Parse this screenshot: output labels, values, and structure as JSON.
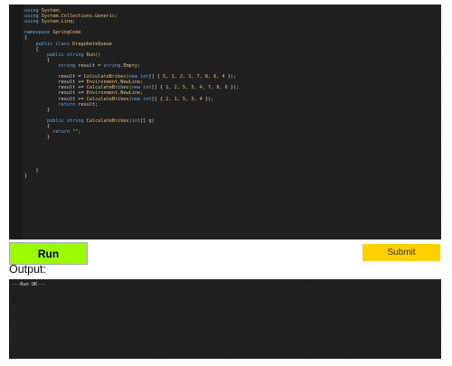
{
  "editor": {
    "lines": [
      [
        {
          "t": "using",
          "c": "kw"
        },
        {
          "t": " System;",
          "c": "type"
        }
      ],
      [
        {
          "t": "using",
          "c": "kw"
        },
        {
          "t": " System.Collections.Generic;",
          "c": "type"
        }
      ],
      [
        {
          "t": "using",
          "c": "kw"
        },
        {
          "t": " System.Linq;",
          "c": "type"
        }
      ],
      [
        {
          "t": "",
          "c": "plain"
        }
      ],
      [
        {
          "t": "namespace",
          "c": "kw"
        },
        {
          "t": " SpringCode",
          "c": "type"
        }
      ],
      [
        {
          "t": "{",
          "c": "plain"
        }
      ],
      [
        {
          "t": "    public class",
          "c": "kw"
        },
        {
          "t": " DragobeteQueue",
          "c": "type"
        }
      ],
      [
        {
          "t": "    {",
          "c": "plain"
        }
      ],
      [
        {
          "t": "        public string",
          "c": "kw"
        },
        {
          "t": " Run()",
          "c": "type"
        }
      ],
      [
        {
          "t": "        {",
          "c": "plain"
        }
      ],
      [
        {
          "t": "            string",
          "c": "kw"
        },
        {
          "t": " result = ",
          "c": "plain"
        },
        {
          "t": "string",
          "c": "kw"
        },
        {
          "t": ".Empty;",
          "c": "type"
        }
      ],
      [
        {
          "t": "",
          "c": "plain"
        }
      ],
      [
        {
          "t": "            result = ",
          "c": "plain"
        },
        {
          "t": "CalculateBribes(",
          "c": "type"
        },
        {
          "t": "new int",
          "c": "kw"
        },
        {
          "t": "[] { ",
          "c": "plain"
        },
        {
          "t": "5, 1, 2, 3, 7, 8, 6, 4",
          "c": "num"
        },
        {
          "t": " });",
          "c": "plain"
        }
      ],
      [
        {
          "t": "            result += ",
          "c": "plain"
        },
        {
          "t": "Environment.NewLine;",
          "c": "type"
        }
      ],
      [
        {
          "t": "            result += ",
          "c": "plain"
        },
        {
          "t": "CalculateBribes(",
          "c": "type"
        },
        {
          "t": "new int",
          "c": "kw"
        },
        {
          "t": "[] { ",
          "c": "plain"
        },
        {
          "t": "1, 2, 5, 3, 4, 7, 8, 6",
          "c": "num"
        },
        {
          "t": " });",
          "c": "plain"
        }
      ],
      [
        {
          "t": "            result += ",
          "c": "plain"
        },
        {
          "t": "Environment.NewLine;",
          "c": "type"
        }
      ],
      [
        {
          "t": "            result += ",
          "c": "plain"
        },
        {
          "t": "CalculateBribes(",
          "c": "type"
        },
        {
          "t": "new int",
          "c": "kw"
        },
        {
          "t": "[] { ",
          "c": "plain"
        },
        {
          "t": "2, 1, 5, 3, 4",
          "c": "num"
        },
        {
          "t": " });",
          "c": "plain"
        }
      ],
      [
        {
          "t": "            return",
          "c": "kw"
        },
        {
          "t": " result;",
          "c": "plain"
        }
      ],
      [
        {
          "t": "        }",
          "c": "plain"
        }
      ],
      [
        {
          "t": "",
          "c": "plain"
        }
      ],
      [
        {
          "t": "        public string",
          "c": "kw"
        },
        {
          "t": " CalculateBribes(",
          "c": "type"
        },
        {
          "t": "int",
          "c": "kw"
        },
        {
          "t": "[] q)",
          "c": "plain"
        }
      ],
      [
        {
          "t": "        {",
          "c": "plain"
        }
      ],
      [
        {
          "t": "          return",
          "c": "kw"
        },
        {
          "t": " \"\";",
          "c": "str"
        }
      ],
      [
        {
          "t": "        }",
          "c": "plain"
        }
      ],
      [
        {
          "t": "",
          "c": "plain"
        }
      ],
      [
        {
          "t": "",
          "c": "plain"
        }
      ],
      [
        {
          "t": "",
          "c": "plain"
        }
      ],
      [
        {
          "t": "",
          "c": "plain"
        }
      ],
      [
        {
          "t": "",
          "c": "plain"
        }
      ],
      [
        {
          "t": "    }",
          "c": "plain"
        }
      ],
      [
        {
          "t": "}",
          "c": "plain"
        }
      ]
    ]
  },
  "controls": {
    "run_label": "Run",
    "submit_label": "Submit"
  },
  "output": {
    "label": "Output:",
    "text": "---Run OK---"
  },
  "colors": {
    "run_button": "#9bfc00",
    "submit_button": "#ffd000",
    "editor_background": "#1d1d1d",
    "keyword": "#6fa8dc",
    "type": "#e6c07b"
  }
}
